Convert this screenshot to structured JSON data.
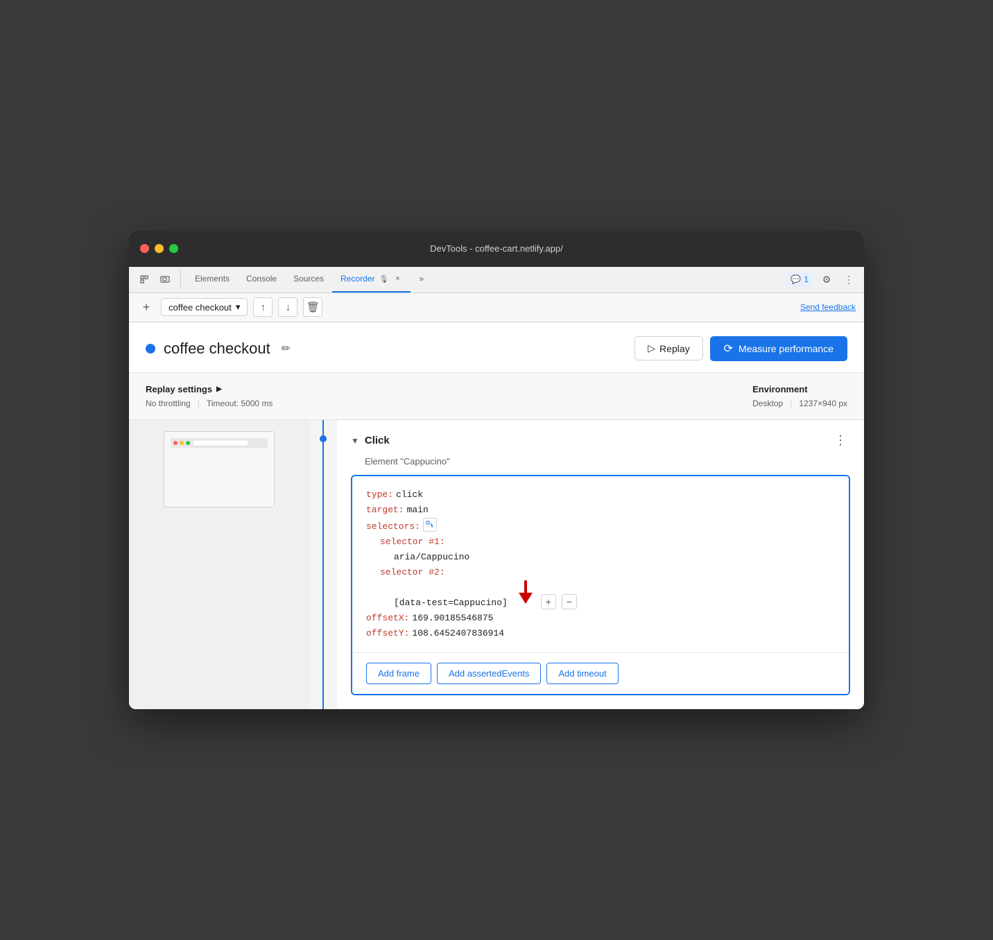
{
  "window": {
    "title": "DevTools - coffee-cart.netlify.app/"
  },
  "tabs": {
    "items": [
      {
        "label": "Elements",
        "active": false
      },
      {
        "label": "Console",
        "active": false
      },
      {
        "label": "Sources",
        "active": false
      },
      {
        "label": "Recorder",
        "active": true
      },
      {
        "label": "»",
        "active": false
      }
    ],
    "recorder_close": "×",
    "badge_count": "1",
    "settings_icon": "⚙",
    "more_icon": "⋮"
  },
  "toolbar": {
    "add_icon": "+",
    "recording_name": "coffee checkout",
    "dropdown_icon": "▾",
    "export_icon": "↑",
    "import_icon": "↓",
    "delete_icon": "🗑",
    "send_feedback": "Send feedback"
  },
  "main_header": {
    "title": "coffee checkout",
    "edit_icon": "✏",
    "replay_label": "Replay",
    "measure_label": "Measure performance"
  },
  "settings": {
    "title": "Replay settings",
    "chevron": "▶",
    "no_throttling": "No throttling",
    "timeout": "Timeout: 5000 ms",
    "env_title": "Environment",
    "env_device": "Desktop",
    "env_size": "1237×940 px"
  },
  "step": {
    "type": "Click",
    "element": "Element \"Cappucino\"",
    "more_icon": "⋮",
    "code": {
      "type_key": "type:",
      "type_val": "click",
      "target_key": "target:",
      "target_val": "main",
      "selectors_key": "selectors:",
      "selector1_key": "selector #1:",
      "selector1_val": "aria/Cappucino",
      "selector2_key": "selector #2:",
      "selector2_val": "[data-test=Cappucino]",
      "offsetX_key": "offsetX:",
      "offsetX_val": "169.90185546875",
      "offsetY_key": "offsetY:",
      "offsetY_val": "108.6452407836914"
    },
    "actions": {
      "add_frame": "Add frame",
      "add_asserted_events": "Add assertedEvents",
      "add_timeout": "Add timeout"
    }
  },
  "colors": {
    "accent": "#1a73e8",
    "dot_recording": "#1a73e8",
    "timeline": "#1a73e8",
    "arrow": "#cc0000"
  }
}
